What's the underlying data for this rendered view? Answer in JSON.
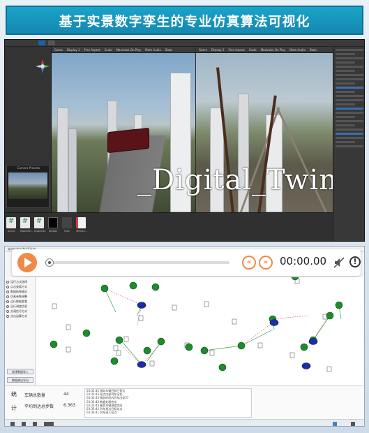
{
  "banner": {
    "title": "基于实景数字孪生的专业仿真算法可视化"
  },
  "unity": {
    "tabs_left": [
      "Game",
      "Display 1",
      "Free Aspect",
      "Scale",
      "Maximize On Play",
      "Mute Audio",
      "Stats",
      "Gizmos"
    ],
    "tabs_right": [
      "Game",
      "Display 2",
      "Free Aspect",
      "Scale",
      "Maximize On Play",
      "Mute Audio",
      "Stats",
      "Gizmos"
    ],
    "camera_preview": "Camera Preview",
    "overlay_text": "_Digital_Twin",
    "inspector_sections": [
      "Audio Listener",
      "Post-process Volume",
      "Post-process Layer"
    ],
    "assets": [
      {
        "label": "#",
        "name": "Script"
      },
      {
        "label": "#",
        "name": "ModelNe..."
      },
      {
        "label": "#",
        "name": "Inspector"
      },
      {
        "label": "",
        "name": "Skybox"
      },
      {
        "label": "",
        "name": "Train"
      },
      {
        "label": "",
        "name": "Vehicle..."
      }
    ]
  },
  "sim": {
    "titlebar": "城市轨道交通仿真系统",
    "player": {
      "timecode": "00:00.00",
      "progress": 0
    },
    "options": [
      "运行方式选择",
      "点击查看方式",
      "数据结果输出",
      "仿真参数调整",
      "运行数据查看",
      "运行调度信息",
      "交通信号方式",
      "点击运算方式"
    ],
    "buttons": [
      "选择数据导入",
      "数据输出导出"
    ],
    "stats": [
      {
        "label": "车辆总数量",
        "value": "44"
      },
      {
        "label": "平均到达总步数",
        "value": "6.363"
      }
    ],
    "side_chars": [
      "统",
      "计"
    ],
    "log": [
      "03:35:45 服务车辆目标已到达",
      "03:35:43 站点内部列车出发",
      "03:35:43 服务时间内列车出发37",
      "03:35:43 数据处理完毕",
      "03:35:43 服务车辆调度完成",
      "03:35:43 列车到达目标站点",
      "03:36:41 列车进入站点"
    ]
  },
  "colors": {
    "accent": "#f08a47",
    "banner": "#1aa3c8",
    "node_green": "#1f8a2e",
    "node_blue": "#1b2fa3"
  }
}
